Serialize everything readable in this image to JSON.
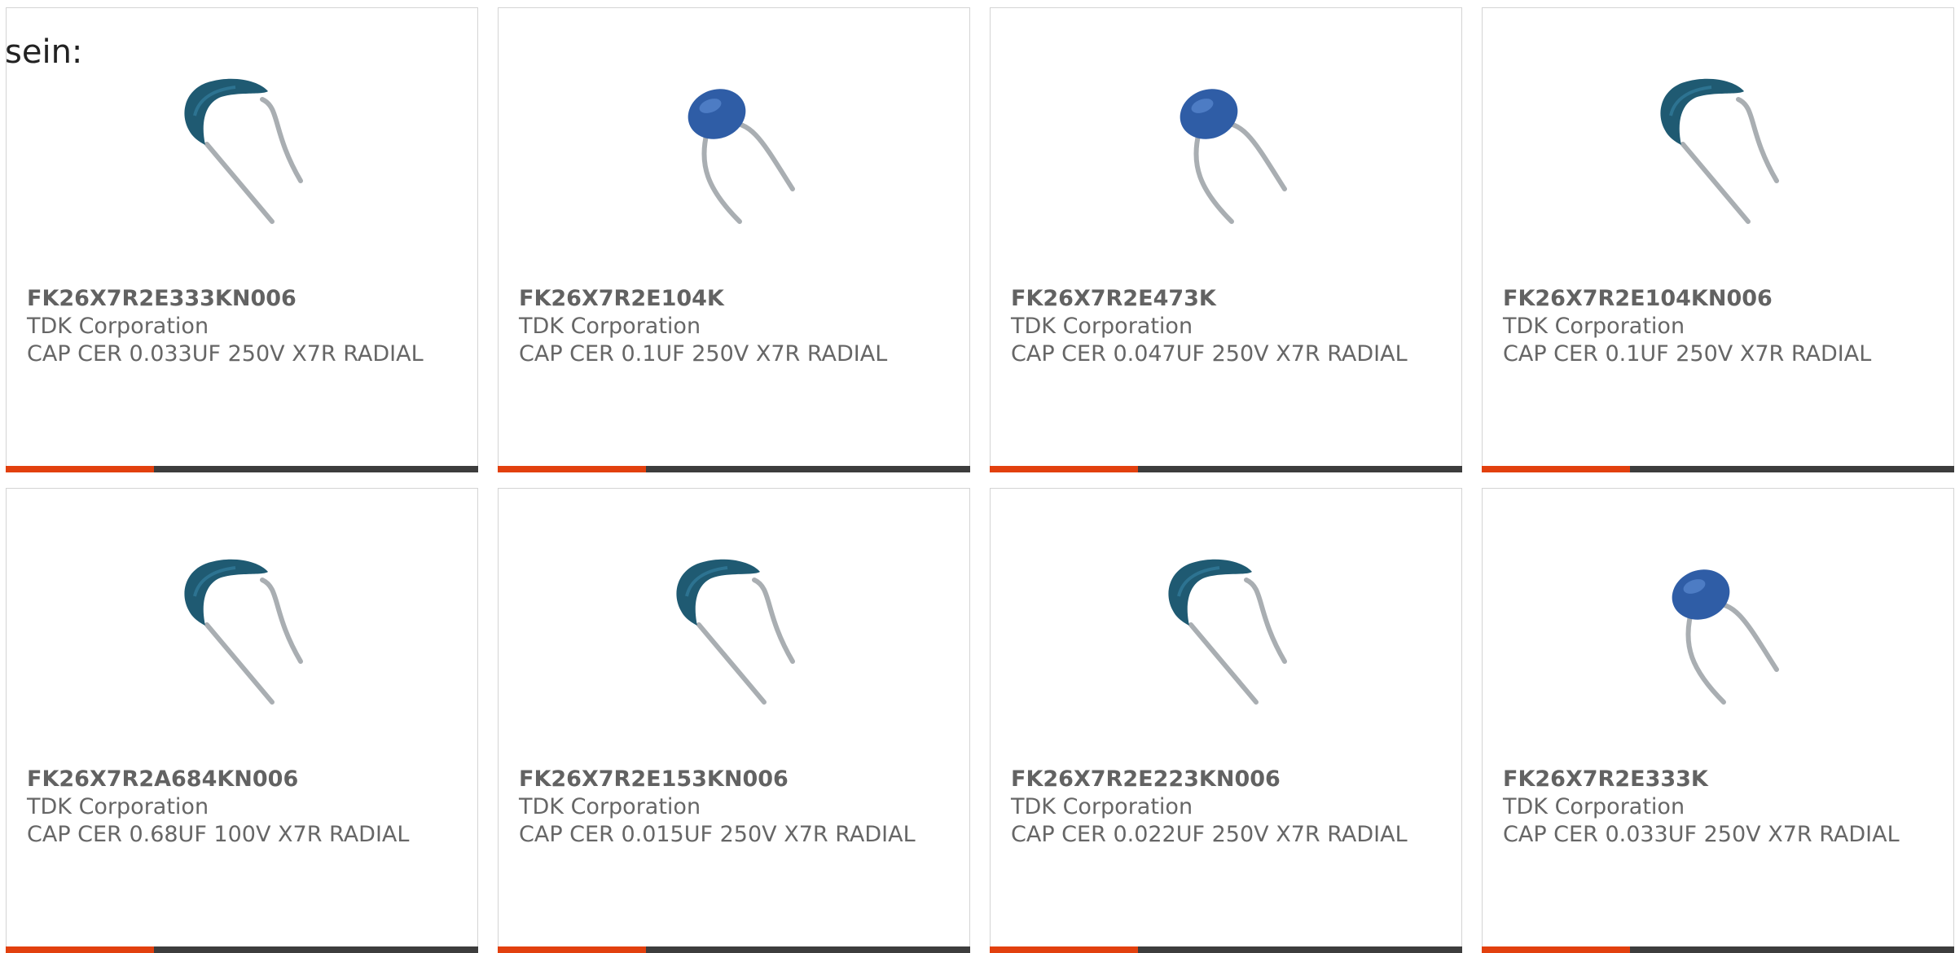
{
  "intro_text": "sein:",
  "colors": {
    "accent": "#e2400e",
    "bar": "#3d3d3d",
    "text": "#666666",
    "capacitor_blue": "#2f5da6",
    "capacitor_teal": "#1f5a72"
  },
  "products": [
    {
      "part_number": "FK26X7R2E333KN006",
      "manufacturer": "TDK Corporation",
      "description": "CAP CER 0.033UF 250V X7R RADIAL",
      "image_icon": "capacitor-teal-large-icon"
    },
    {
      "part_number": "FK26X7R2E104K",
      "manufacturer": "TDK Corporation",
      "description": "CAP CER 0.1UF 250V X7R RADIAL",
      "image_icon": "capacitor-blue-small-icon"
    },
    {
      "part_number": "FK26X7R2E473K",
      "manufacturer": "TDK Corporation",
      "description": "CAP CER 0.047UF 250V X7R RADIAL",
      "image_icon": "capacitor-blue-small-icon"
    },
    {
      "part_number": "FK26X7R2E104KN006",
      "manufacturer": "TDK Corporation",
      "description": "CAP CER 0.1UF 250V X7R RADIAL",
      "image_icon": "capacitor-teal-large-icon"
    },
    {
      "part_number": "FK26X7R2A684KN006",
      "manufacturer": "TDK Corporation",
      "description": "CAP CER 0.68UF 100V X7R RADIAL",
      "image_icon": "capacitor-teal-large-icon"
    },
    {
      "part_number": "FK26X7R2E153KN006",
      "manufacturer": "TDK Corporation",
      "description": "CAP CER 0.015UF 250V X7R RADIAL",
      "image_icon": "capacitor-teal-large-icon"
    },
    {
      "part_number": "FK26X7R2E223KN006",
      "manufacturer": "TDK Corporation",
      "description": "CAP CER 0.022UF 250V X7R RADIAL",
      "image_icon": "capacitor-teal-large-icon"
    },
    {
      "part_number": "FK26X7R2E333K",
      "manufacturer": "TDK Corporation",
      "description": "CAP CER 0.033UF 250V X7R RADIAL",
      "image_icon": "capacitor-blue-small-icon"
    }
  ]
}
